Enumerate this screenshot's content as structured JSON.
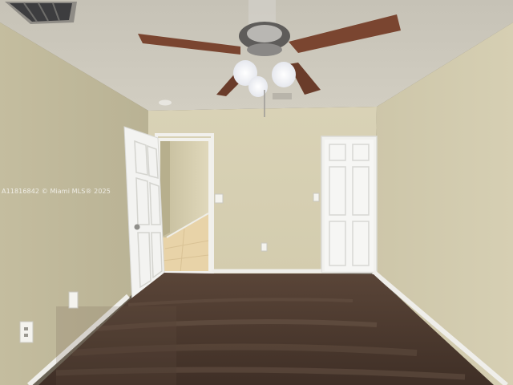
{
  "photo": {
    "watermark_text": "A11816842 © Miami MLS® 2025"
  },
  "colors": {
    "wall_light": "#d3ccb0",
    "wall_shadow": "#bdb596",
    "ceiling": "#cfcbc0",
    "carpet": "#4d3a2f",
    "door": "#f4f4f2",
    "baseboard": "#ededea",
    "hallway_floor": "#e9d5aa",
    "fan_blade": "#7a4530"
  }
}
